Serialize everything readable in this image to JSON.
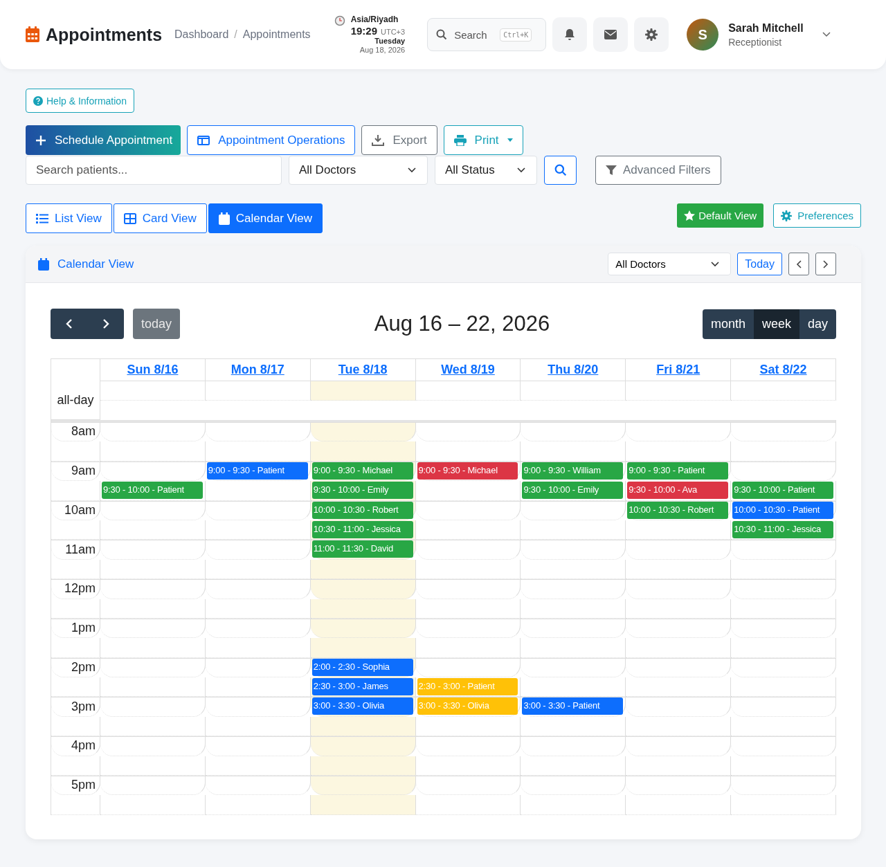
{
  "header": {
    "title": "Appointments",
    "breadcrumbs": [
      "Dashboard",
      "Appointments"
    ],
    "breadcrumb_separator": "/",
    "clock": {
      "zone": "Asia/Riyadh",
      "time": "19:29",
      "offset": "UTC+3",
      "weekday": "Tuesday",
      "date": "Aug 18, 2026"
    },
    "search": {
      "placeholder": "Search",
      "shortcut": "Ctrl+K"
    },
    "user": {
      "initial": "S",
      "name": "Sarah Mitchell",
      "role": "Receptionist"
    }
  },
  "help_button": "Help & Information",
  "actions": [
    {
      "label": "Schedule Appointment",
      "kind": "primary"
    },
    {
      "label": "Appointment Operations",
      "kind": "outline-blue"
    },
    {
      "label": "Export",
      "kind": "outline-grey"
    },
    {
      "label": "Print",
      "kind": "outline-teal"
    }
  ],
  "filters": {
    "search_placeholder": "Search patients...",
    "doctor": "All Doctors",
    "status": "All Status",
    "advanced": "Advanced Filters"
  },
  "views": [
    {
      "label": "List View",
      "selected": false
    },
    {
      "label": "Card View",
      "selected": false
    },
    {
      "label": "Calendar View",
      "selected": true
    }
  ],
  "default_view": "Default View",
  "preferences": "Preferences",
  "panel": {
    "title": "Calendar View",
    "doctor": "All Doctors",
    "today": "Today"
  },
  "calendar": {
    "today_button": "today",
    "range": "Aug 16 – 22, 2026",
    "all_day": "all-day",
    "modes": [
      {
        "label": "month",
        "selected": false
      },
      {
        "label": "week",
        "selected": true
      },
      {
        "label": "day",
        "selected": false
      }
    ],
    "days": [
      {
        "label": "Sun 8/16",
        "today": false
      },
      {
        "label": "Mon 8/17",
        "today": false
      },
      {
        "label": "Tue 8/18",
        "today": true
      },
      {
        "label": "Wed 8/19",
        "today": false
      },
      {
        "label": "Thu 8/20",
        "today": false
      },
      {
        "label": "Fri 8/21",
        "today": false
      },
      {
        "label": "Sat 8/22",
        "today": false
      }
    ],
    "hours": [
      {
        "label": "8am",
        "halves": [
          [
            {
              "booked": false
            },
            {
              "booked": false
            },
            {
              "booked": false
            },
            {
              "booked": false
            },
            {
              "booked": false
            },
            {
              "booked": false
            },
            {
              "booked": false
            }
          ],
          [
            {
              "booked": false
            },
            {
              "booked": false
            },
            {
              "booked": false
            },
            {
              "booked": false
            },
            {
              "booked": false
            },
            {
              "booked": false
            },
            {
              "booked": false
            }
          ]
        ]
      },
      {
        "label": "9am",
        "halves": [
          [
            {
              "booked": false
            },
            {
              "booked": true,
              "text": "9:00 - 9:30 - Patient",
              "color": "#0d6efd"
            },
            {
              "booked": true,
              "text": "9:00 - 9:30 - Michael",
              "color": "#28a745"
            },
            {
              "booked": true,
              "text": "9:00 - 9:30 - Michael",
              "color": "#dc3545"
            },
            {
              "booked": true,
              "text": "9:00 - 9:30 - William",
              "color": "#28a745"
            },
            {
              "booked": true,
              "text": "9:00 - 9:30 - Patient",
              "color": "#28a745"
            },
            {
              "booked": false
            }
          ],
          [
            {
              "booked": true,
              "text": "9:30 - 10:00 - Patient",
              "color": "#28a745"
            },
            {
              "booked": false
            },
            {
              "booked": true,
              "text": "9:30 - 10:00 - Emily",
              "color": "#28a745"
            },
            {
              "booked": false
            },
            {
              "booked": true,
              "text": "9:30 - 10:00 - Emily",
              "color": "#28a745"
            },
            {
              "booked": true,
              "text": "9:30 - 10:00 - Ava",
              "color": "#dc3545"
            },
            {
              "booked": true,
              "text": "9:30 - 10:00 - Patient",
              "color": "#28a745"
            }
          ]
        ]
      },
      {
        "label": "10am",
        "halves": [
          [
            {
              "booked": false
            },
            {
              "booked": false
            },
            {
              "booked": true,
              "text": "10:00 - 10:30 - Robert",
              "color": "#28a745"
            },
            {
              "booked": false
            },
            {
              "booked": false
            },
            {
              "booked": true,
              "text": "10:00 - 10:30 - Robert",
              "color": "#28a745"
            },
            {
              "booked": true,
              "text": "10:00 - 10:30 - Patient",
              "color": "#0d6efd"
            }
          ],
          [
            {
              "booked": false
            },
            {
              "booked": false
            },
            {
              "booked": true,
              "text": "10:30 - 11:00 - Jessica",
              "color": "#28a745"
            },
            {
              "booked": false
            },
            {
              "booked": false
            },
            {
              "booked": false
            },
            {
              "booked": true,
              "text": "10:30 - 11:00 - Jessica",
              "color": "#28a745"
            }
          ]
        ]
      },
      {
        "label": "11am",
        "halves": [
          [
            {
              "booked": false
            },
            {
              "booked": false
            },
            {
              "booked": true,
              "text": "11:00 - 11:30 - David",
              "color": "#28a745"
            },
            {
              "booked": false
            },
            {
              "booked": false
            },
            {
              "booked": false
            },
            {
              "booked": false
            }
          ],
          [
            {
              "booked": false
            },
            {
              "booked": false
            },
            {
              "booked": false
            },
            {
              "booked": false
            },
            {
              "booked": false
            },
            {
              "booked": false
            },
            {
              "booked": false
            }
          ]
        ]
      },
      {
        "label": "12pm",
        "halves": [
          [
            {
              "booked": false
            },
            {
              "booked": false
            },
            {
              "booked": false
            },
            {
              "booked": false
            },
            {
              "booked": false
            },
            {
              "booked": false
            },
            {
              "booked": false
            }
          ],
          [
            {
              "booked": false
            },
            {
              "booked": false
            },
            {
              "booked": false
            },
            {
              "booked": false
            },
            {
              "booked": false
            },
            {
              "booked": false
            },
            {
              "booked": false
            }
          ]
        ]
      },
      {
        "label": "1pm",
        "halves": [
          [
            {
              "booked": false
            },
            {
              "booked": false
            },
            {
              "booked": false
            },
            {
              "booked": false
            },
            {
              "booked": false
            },
            {
              "booked": false
            },
            {
              "booked": false
            }
          ],
          [
            {
              "booked": false
            },
            {
              "booked": false
            },
            {
              "booked": false
            },
            {
              "booked": false
            },
            {
              "booked": false
            },
            {
              "booked": false
            },
            {
              "booked": false
            }
          ]
        ]
      },
      {
        "label": "2pm",
        "halves": [
          [
            {
              "booked": false
            },
            {
              "booked": false
            },
            {
              "booked": true,
              "text": "2:00 - 2:30 - Sophia",
              "color": "#0d6efd"
            },
            {
              "booked": false
            },
            {
              "booked": false
            },
            {
              "booked": false
            },
            {
              "booked": false
            }
          ],
          [
            {
              "booked": false
            },
            {
              "booked": false
            },
            {
              "booked": true,
              "text": "2:30 - 3:00 - James",
              "color": "#0d6efd"
            },
            {
              "booked": true,
              "text": "2:30 - 3:00 - Patient",
              "color": "#ffc107"
            },
            {
              "booked": false
            },
            {
              "booked": false
            },
            {
              "booked": false
            }
          ]
        ]
      },
      {
        "label": "3pm",
        "halves": [
          [
            {
              "booked": false
            },
            {
              "booked": false
            },
            {
              "booked": true,
              "text": "3:00 - 3:30 - Olivia",
              "color": "#0d6efd"
            },
            {
              "booked": true,
              "text": "3:00 - 3:30 - Olivia",
              "color": "#ffc107"
            },
            {
              "booked": true,
              "text": "3:00 - 3:30 - Patient",
              "color": "#0d6efd"
            },
            {
              "booked": false
            },
            {
              "booked": false
            }
          ],
          [
            {
              "booked": false
            },
            {
              "booked": false
            },
            {
              "booked": false
            },
            {
              "booked": false
            },
            {
              "booked": false
            },
            {
              "booked": false
            },
            {
              "booked": false
            }
          ]
        ]
      },
      {
        "label": "4pm",
        "halves": [
          [
            {
              "booked": false
            },
            {
              "booked": false
            },
            {
              "booked": false
            },
            {
              "booked": false
            },
            {
              "booked": false
            },
            {
              "booked": false
            },
            {
              "booked": false
            }
          ],
          [
            {
              "booked": false
            },
            {
              "booked": false
            },
            {
              "booked": false
            },
            {
              "booked": false
            },
            {
              "booked": false
            },
            {
              "booked": false
            },
            {
              "booked": false
            }
          ]
        ]
      },
      {
        "label": "5pm",
        "halves": [
          [
            {
              "booked": false
            },
            {
              "booked": false
            },
            {
              "booked": false
            },
            {
              "booked": false
            },
            {
              "booked": false
            },
            {
              "booked": false
            },
            {
              "booked": false
            }
          ],
          [
            {
              "booked": false
            },
            {
              "booked": false
            },
            {
              "booked": false
            },
            {
              "booked": false
            },
            {
              "booked": false
            },
            {
              "booked": false
            },
            {
              "booked": false
            }
          ]
        ]
      }
    ]
  }
}
